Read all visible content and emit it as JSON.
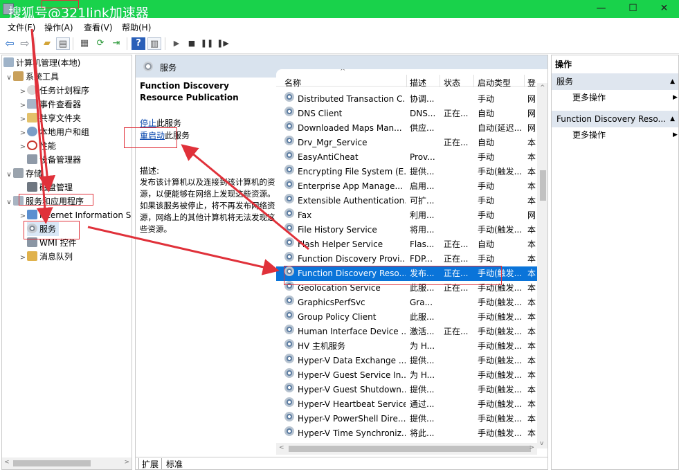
{
  "window": {
    "watermark": "搜狐号@321link加速器",
    "controls": [
      "—",
      "☐",
      "✕"
    ]
  },
  "menubar": [
    "文件(F)",
    "操作(A)",
    "查看(V)",
    "帮助(H)"
  ],
  "toolbar": {
    "icons": [
      "back-arrow-icon",
      "forward-arrow-icon",
      "up-folder-icon",
      "show-tree-icon",
      "properties-icon",
      "refresh-icon",
      "export-icon",
      "help-icon",
      "view-icon",
      "play-icon",
      "stop-icon",
      "pause-icon",
      "restart-icon"
    ]
  },
  "tree": {
    "items": [
      {
        "label": "计算机管理(本地)",
        "arrow": ""
      },
      {
        "label": "系统工具",
        "arrow": "∨"
      },
      {
        "label": "任务计划程序",
        "arrow": ">"
      },
      {
        "label": "事件查看器",
        "arrow": ">"
      },
      {
        "label": "共享文件夹",
        "arrow": ">"
      },
      {
        "label": "本地用户和组",
        "arrow": ">"
      },
      {
        "label": "性能",
        "arrow": ">"
      },
      {
        "label": "设备管理器",
        "arrow": ""
      },
      {
        "label": "存储",
        "arrow": "∨"
      },
      {
        "label": "磁盘管理",
        "arrow": ""
      },
      {
        "label": "服务和应用程序",
        "arrow": "∨"
      },
      {
        "label": "Internet Information S",
        "arrow": ">"
      },
      {
        "label": "服务",
        "arrow": ""
      },
      {
        "label": "WMI 控件",
        "arrow": ""
      },
      {
        "label": "消息队列",
        "arrow": ">"
      }
    ]
  },
  "middle": {
    "header": "服务",
    "ext": {
      "title": "Function Discovery Resource Publication",
      "stop_link": "停止",
      "stop_suffix": "此服务",
      "restart_link": "重启动",
      "restart_suffix": "此服务",
      "desc_label": "描述:",
      "desc_text": "发布该计算机以及连接到该计算机的资源，以便能够在网络上发现这些资源。如果该服务被停止，将不再发布网络资源，网络上的其他计算机将无法发现这些资源。"
    },
    "columns": [
      "名称",
      "描述",
      "状态",
      "启动类型",
      "登"
    ],
    "rows": [
      {
        "name": "Distributed Transaction C...",
        "desc": "协调...",
        "status": "",
        "startup": "手动",
        "logon": "网"
      },
      {
        "name": "DNS Client",
        "desc": "DNS...",
        "status": "正在...",
        "startup": "自动",
        "logon": "网"
      },
      {
        "name": "Downloaded Maps Man...",
        "desc": "供应...",
        "status": "",
        "startup": "自动(延迟...",
        "logon": "网"
      },
      {
        "name": "Drv_Mgr_Service",
        "desc": "",
        "status": "正在...",
        "startup": "自动",
        "logon": "本"
      },
      {
        "name": "EasyAntiCheat",
        "desc": "Prov...",
        "status": "",
        "startup": "手动",
        "logon": "本"
      },
      {
        "name": "Encrypting File System (E...",
        "desc": "提供...",
        "status": "",
        "startup": "手动(触发...",
        "logon": "本"
      },
      {
        "name": "Enterprise App Manage...",
        "desc": "启用...",
        "status": "",
        "startup": "手动",
        "logon": "本"
      },
      {
        "name": "Extensible Authentication...",
        "desc": "可扩...",
        "status": "",
        "startup": "手动",
        "logon": "本"
      },
      {
        "name": "Fax",
        "desc": "利用...",
        "status": "",
        "startup": "手动",
        "logon": "网"
      },
      {
        "name": "File History Service",
        "desc": "将用...",
        "status": "",
        "startup": "手动(触发...",
        "logon": "本"
      },
      {
        "name": "Flash Helper Service",
        "desc": "Flas...",
        "status": "正在...",
        "startup": "自动",
        "logon": "本"
      },
      {
        "name": "Function Discovery Provi...",
        "desc": "FDP...",
        "status": "正在...",
        "startup": "手动",
        "logon": "本"
      },
      {
        "name": "Function Discovery Reso...",
        "desc": "发布...",
        "status": "正在...",
        "startup": "手动(触发...",
        "logon": "本"
      },
      {
        "name": "Geolocation Service",
        "desc": "此服...",
        "status": "正在...",
        "startup": "手动(触发...",
        "logon": "本"
      },
      {
        "name": "GraphicsPerfSvc",
        "desc": "Gra...",
        "status": "",
        "startup": "手动(触发...",
        "logon": "本"
      },
      {
        "name": "Group Policy Client",
        "desc": "此服...",
        "status": "",
        "startup": "手动(触发...",
        "logon": "本"
      },
      {
        "name": "Human Interface Device ...",
        "desc": "激活...",
        "status": "正在...",
        "startup": "手动(触发...",
        "logon": "本"
      },
      {
        "name": "HV 主机服务",
        "desc": "为 H...",
        "status": "",
        "startup": "手动(触发...",
        "logon": "本"
      },
      {
        "name": "Hyper-V Data Exchange ...",
        "desc": "提供...",
        "status": "",
        "startup": "手动(触发...",
        "logon": "本"
      },
      {
        "name": "Hyper-V Guest Service In...",
        "desc": "为 H...",
        "status": "",
        "startup": "手动(触发...",
        "logon": "本"
      },
      {
        "name": "Hyper-V Guest Shutdown...",
        "desc": "提供...",
        "status": "",
        "startup": "手动(触发...",
        "logon": "本"
      },
      {
        "name": "Hyper-V Heartbeat Service",
        "desc": "通过...",
        "status": "",
        "startup": "手动(触发...",
        "logon": "本"
      },
      {
        "name": "Hyper-V PowerShell Dire...",
        "desc": "提供...",
        "status": "",
        "startup": "手动(触发...",
        "logon": "本"
      },
      {
        "name": "Hyper-V Time Synchroniz...",
        "desc": "将此...",
        "status": "",
        "startup": "手动(触发...",
        "logon": "本"
      }
    ],
    "tabs": [
      "扩展",
      "标准"
    ]
  },
  "actions": {
    "header": "操作",
    "section1": "服务",
    "more1": "更多操作",
    "section2": "Function Discovery Reso...",
    "more2": "更多操作"
  },
  "colors": {
    "titlebar": "#19d24b",
    "selection": "#0a74d9",
    "annotation": "#e0313a"
  }
}
